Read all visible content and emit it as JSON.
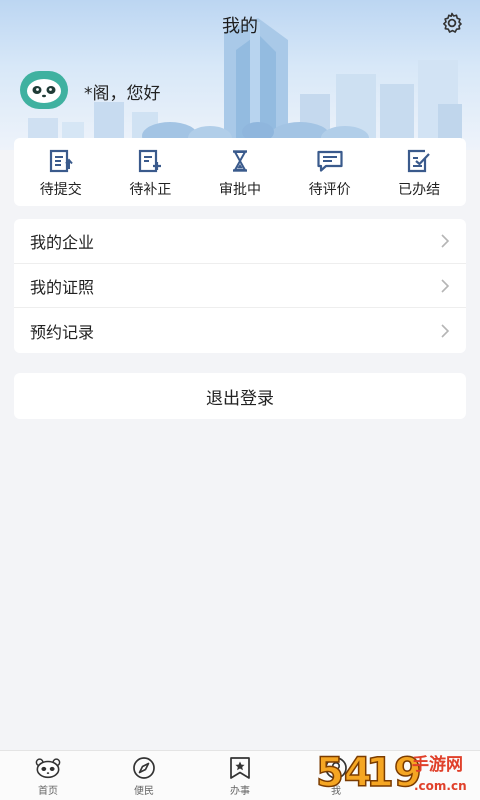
{
  "header": {
    "title": "我的",
    "greeting": "*阁，您好",
    "settings_icon": "gear-icon",
    "avatar_icon": "panda-avatar"
  },
  "status_items": [
    {
      "label": "待提交",
      "icon": "doc-upload-icon"
    },
    {
      "label": "待补正",
      "icon": "doc-plus-icon"
    },
    {
      "label": "审批中",
      "icon": "hourglass-icon"
    },
    {
      "label": "待评价",
      "icon": "comment-icon"
    },
    {
      "label": "已办结",
      "icon": "doc-check-icon"
    }
  ],
  "menu": [
    {
      "label": "我的企业"
    },
    {
      "label": "我的证照"
    },
    {
      "label": "预约记录"
    }
  ],
  "logout_label": "退出登录",
  "bottom_nav": [
    {
      "label": "首页",
      "icon": "panda-icon"
    },
    {
      "label": "便民",
      "icon": "compass-icon"
    },
    {
      "label": "办事",
      "icon": "bookmark-star-icon"
    },
    {
      "label": "我",
      "icon": "user-icon"
    },
    {
      "label": "",
      "icon": ""
    }
  ],
  "watermark": {
    "text": "5419手游网",
    "subtext": ".com.cn"
  },
  "colors": {
    "accent": "#3a5a8c",
    "avatar_bg": "#3fb1a0",
    "page_bg": "#f3f4f7"
  }
}
